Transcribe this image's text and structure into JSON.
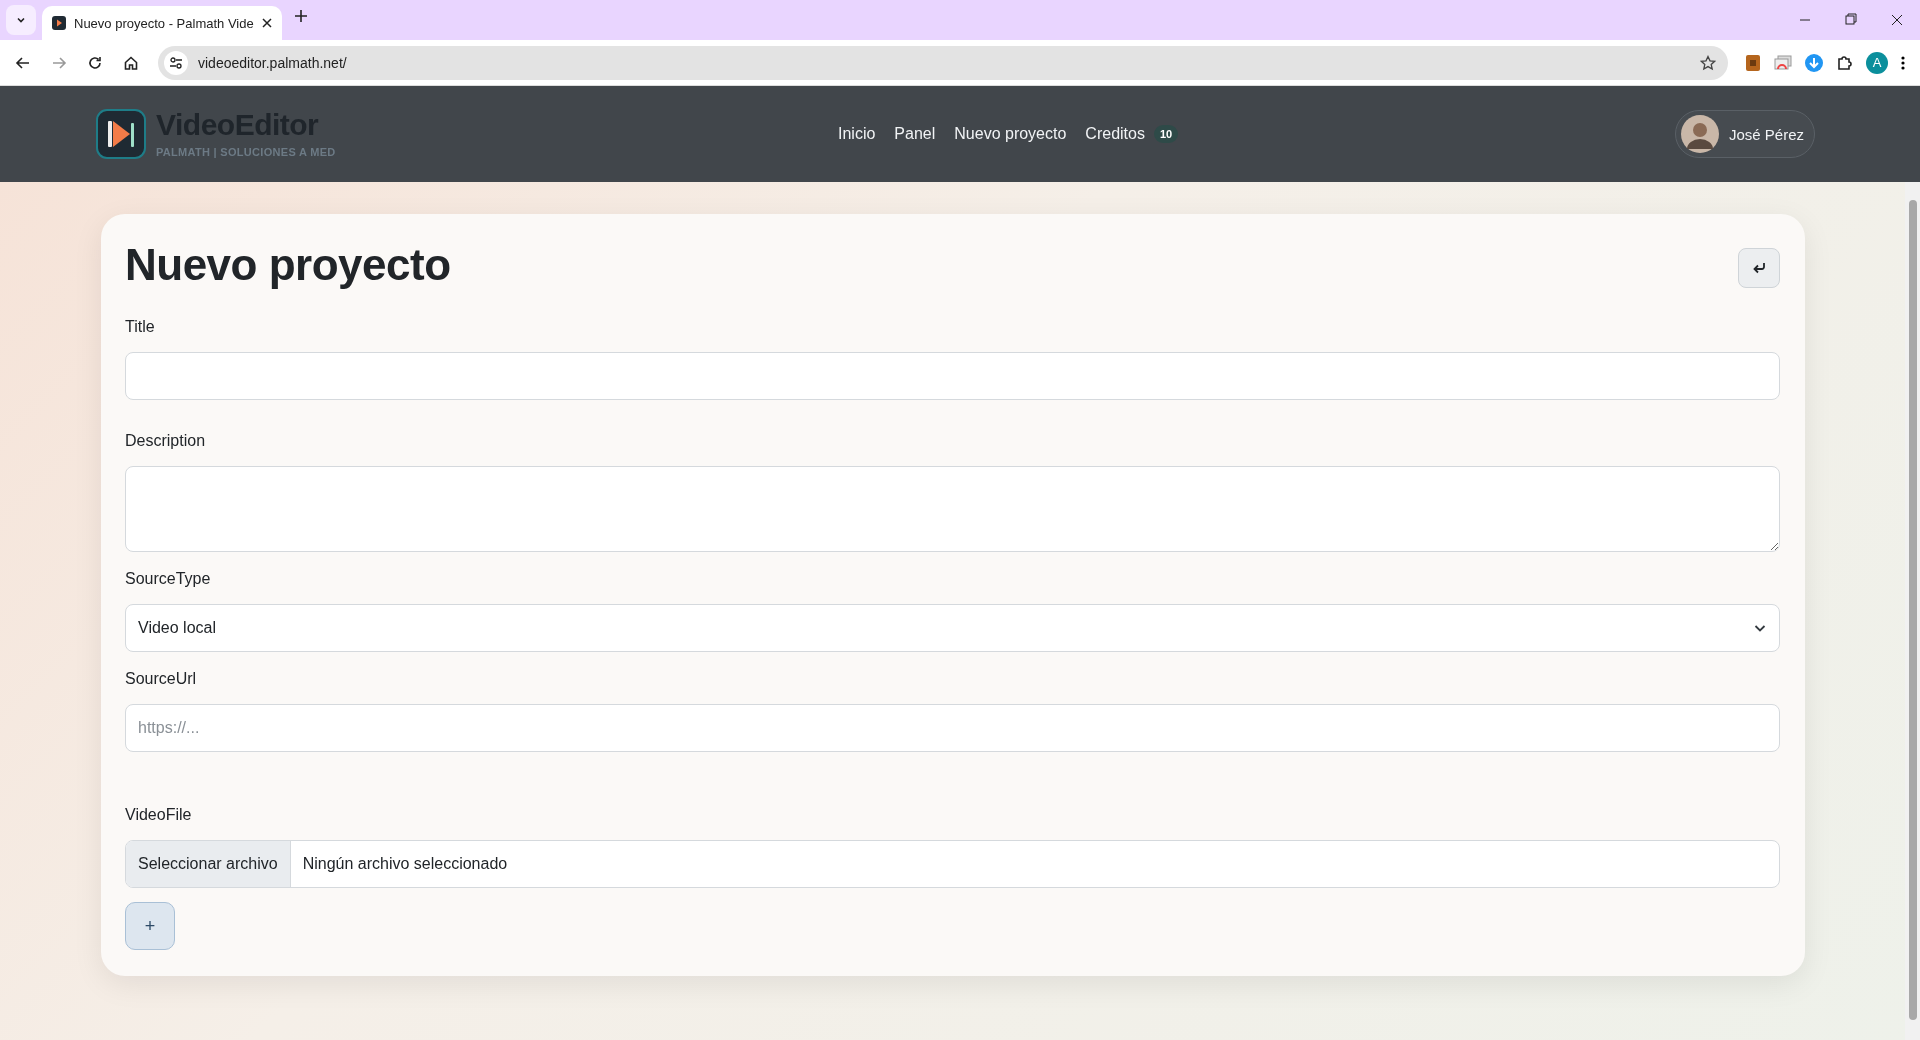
{
  "browser": {
    "tab_title": "Nuevo proyecto - Palmath Vide",
    "url": "videoeditor.palmath.net/",
    "profile_initial": "A"
  },
  "header": {
    "brand": "VideoEditor",
    "tagline": "PALMATH | SOLUCIONES A MED",
    "nav": [
      {
        "label": "Inicio"
      },
      {
        "label": "Panel"
      },
      {
        "label": "Nuevo proyecto"
      },
      {
        "label": "Creditos",
        "badge": "10"
      }
    ],
    "user": "José Pérez"
  },
  "form": {
    "title": "Nuevo proyecto",
    "fields": [
      {
        "kind": "text",
        "label": "Title"
      },
      {
        "kind": "textarea",
        "label": "Description"
      },
      {
        "kind": "select",
        "label": "SourceType",
        "value": "Video local"
      },
      {
        "kind": "url",
        "label": "SourceUrl",
        "placeholder": "https://..."
      },
      {
        "kind": "file",
        "label": "VideoFile",
        "button": "Seleccionar archivo",
        "status": "Ningún archivo seleccionado"
      }
    ],
    "add_button": "+"
  }
}
